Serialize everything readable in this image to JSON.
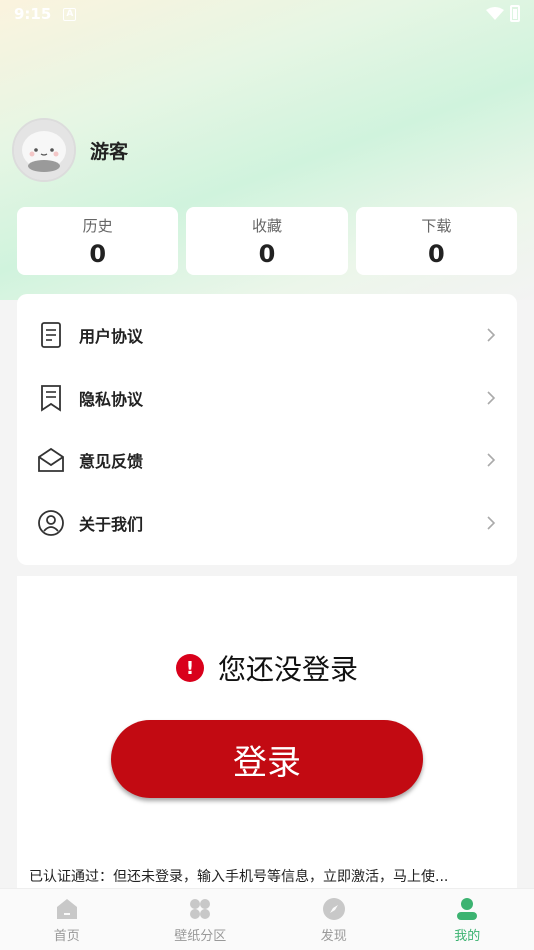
{
  "status_bar": {
    "time": "9:15",
    "notification_letter": "A"
  },
  "profile": {
    "username": "游客"
  },
  "stats": [
    {
      "label": "历史",
      "value": "0"
    },
    {
      "label": "收藏",
      "value": "0"
    },
    {
      "label": "下载",
      "value": "0"
    }
  ],
  "menu": [
    {
      "label": "用户协议",
      "icon": "document-icon"
    },
    {
      "label": "隐私协议",
      "icon": "bookmark-document-icon"
    },
    {
      "label": "意见反馈",
      "icon": "mail-icon"
    },
    {
      "label": "关于我们",
      "icon": "person-circle-icon"
    }
  ],
  "login": {
    "message": "您还没登录",
    "warn_symbol": "!",
    "button_label": "登录",
    "notice": "已认证通过：但还未登录，输入手机号等信息，立即激活，马上使..."
  },
  "tabbar": {
    "tabs": [
      {
        "label": "首页",
        "icon": "home-icon",
        "active": false
      },
      {
        "label": "壁纸分区",
        "icon": "grid-icon",
        "active": false
      },
      {
        "label": "发现",
        "icon": "compass-icon",
        "active": false
      },
      {
        "label": "我的",
        "icon": "user-icon",
        "active": true
      }
    ]
  },
  "colors": {
    "accent": "#3cb371",
    "login_button": "#c20a12",
    "warn": "#d9001b"
  }
}
